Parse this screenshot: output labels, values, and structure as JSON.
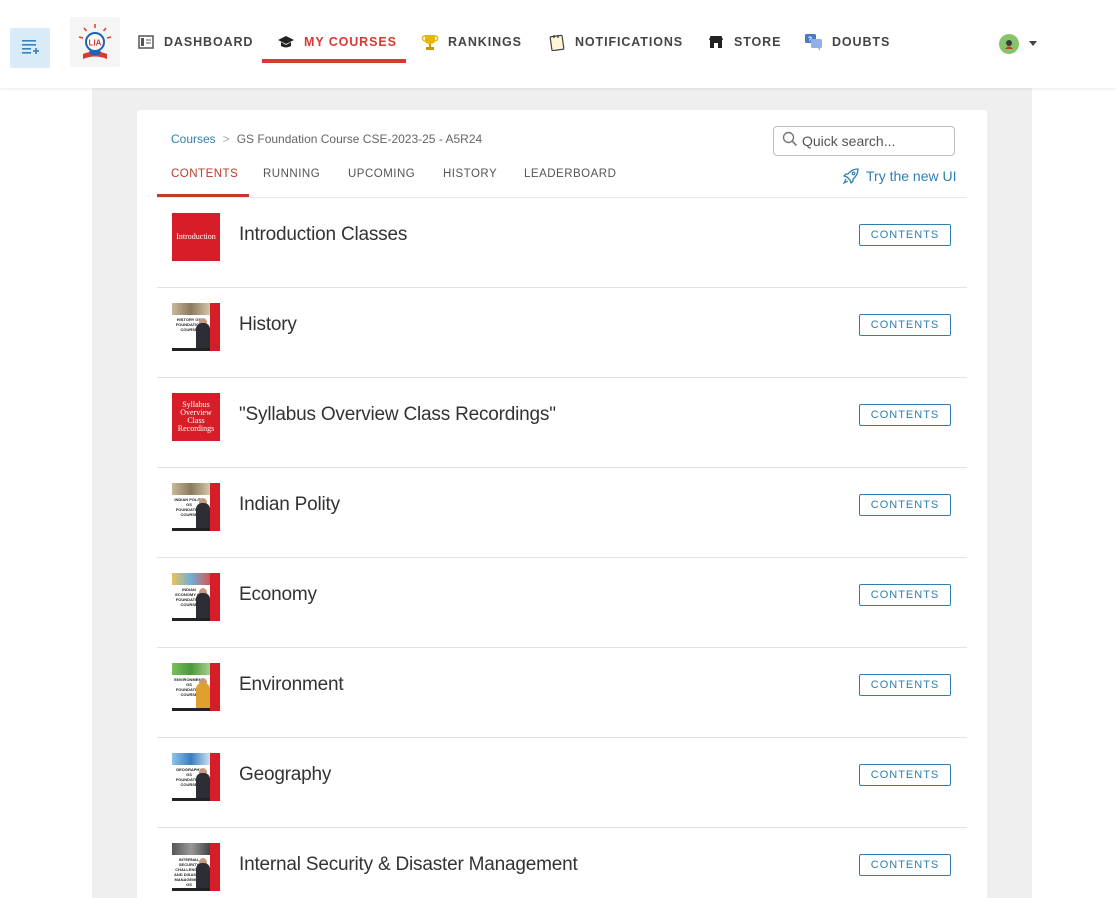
{
  "nav": {
    "items": [
      {
        "label": "DASHBOARD",
        "icon": "dashboard-icon"
      },
      {
        "label": "MY COURSES",
        "icon": "graduation-cap-icon",
        "active": true
      },
      {
        "label": "RANKINGS",
        "icon": "trophy-icon"
      },
      {
        "label": "NOTIFICATIONS",
        "icon": "notepad-icon"
      },
      {
        "label": "STORE",
        "icon": "store-icon"
      },
      {
        "label": "DOUBTS",
        "icon": "chat-question-icon"
      }
    ],
    "logo_text": "LIA"
  },
  "breadcrumb": {
    "root": "Courses",
    "separator": ">",
    "current": "GS Foundation Course CSE-2023-25 - A5R24"
  },
  "search": {
    "placeholder": "Quick search..."
  },
  "tabs": [
    {
      "label": "CONTENTS",
      "active": true
    },
    {
      "label": "RUNNING"
    },
    {
      "label": "UPCOMING"
    },
    {
      "label": "HISTORY"
    },
    {
      "label": "LEADERBOARD"
    }
  ],
  "new_ui_link": "Try the new UI",
  "rows": [
    {
      "title": "Introduction Classes",
      "thumb_text": "Introduction",
      "button": "CONTENTS"
    },
    {
      "title": "History",
      "thumb_text": "HISTORY GS FOUNDATION COURSE",
      "button": "CONTENTS"
    },
    {
      "title": "\"Syllabus Overview Class Recordings\"",
      "thumb_text": "Syllabus Overview Class Recordings",
      "button": "CONTENTS"
    },
    {
      "title": "Indian Polity",
      "thumb_text": "INDIAN POLITY GS FOUNDATION COURSE",
      "button": "CONTENTS"
    },
    {
      "title": "Economy",
      "thumb_text": "INDIAN ECONOMY GS FOUNDATION COURSE",
      "button": "CONTENTS"
    },
    {
      "title": "Environment",
      "thumb_text": "ENVIRONMENT GS FOUNDATION COURSE",
      "button": "CONTENTS"
    },
    {
      "title": "Geography",
      "thumb_text": "GEOGRAPHY GS FOUNDATION COURSE",
      "button": "CONTENTS"
    },
    {
      "title": "Internal Security & Disaster Management",
      "thumb_text": "INTERNAL SECURITY CHALLENGES AND DISASTER MANAGEMENT GS FOUNDATION COURSE",
      "button": "CONTENTS"
    }
  ],
  "colors": {
    "accent_red": "#d63a33",
    "link_blue": "#2e7fb0",
    "thumb_red": "#d71e28",
    "page_gray": "#efefef"
  }
}
